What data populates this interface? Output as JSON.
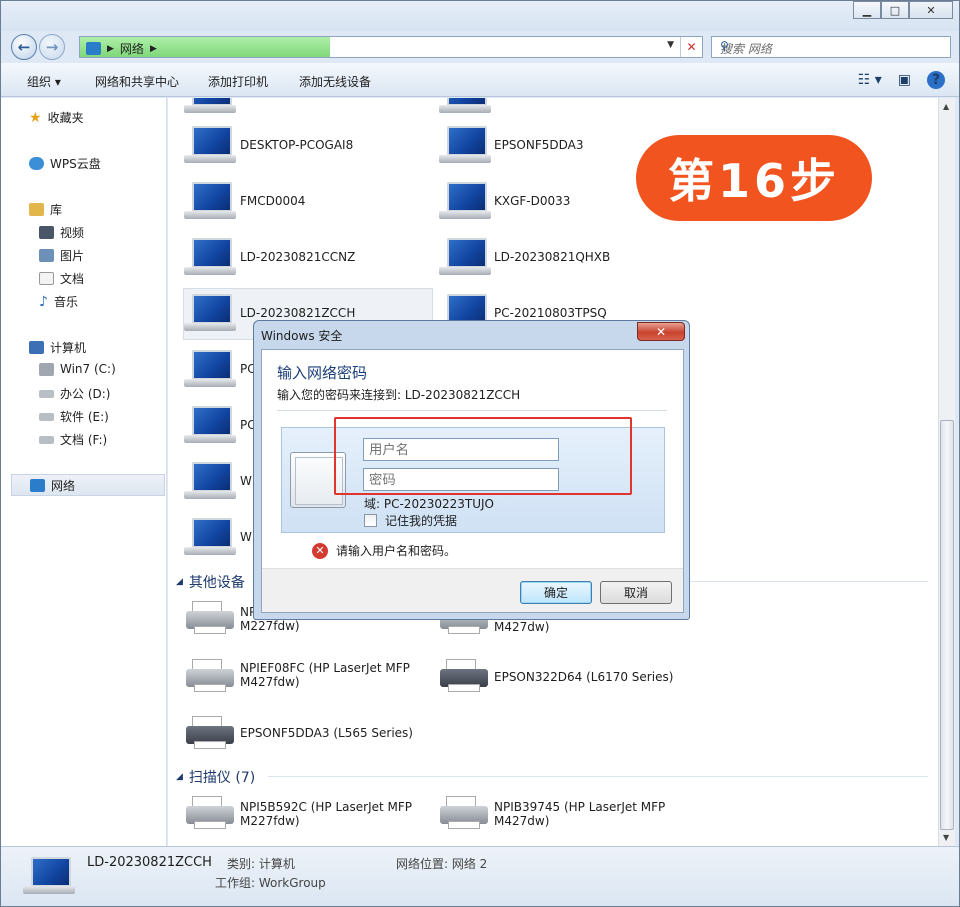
{
  "titlebar": {
    "buttons": [
      "minimize-icon",
      "maximize-icon",
      "close-icon"
    ]
  },
  "address": {
    "back_icon": "back-arrow-icon",
    "forward_icon": "forward-arrow-icon",
    "crumb": "网络",
    "search_placeholder": "搜索 网络"
  },
  "toolbar": {
    "organize": "组织",
    "network_center": "网络和共享中心",
    "add_printer": "添加打印机",
    "add_wireless": "添加无线设备"
  },
  "sidebar": {
    "favorites": "收藏夹",
    "wps": "WPS云盘",
    "libraries": "库",
    "lib_items": [
      "视频",
      "图片",
      "文档",
      "音乐"
    ],
    "computer": "计算机",
    "drives": [
      "Win7 (C:)",
      "办公 (D:)",
      "软件 (E:)",
      "文档 (F:)"
    ],
    "network": "网络"
  },
  "computers": {
    "col1": [
      "DESKTOP-PCOGAI8",
      "FMCD0004",
      "LD-20230821CCNZ",
      "LD-20230821ZCCH",
      "PC",
      "PC",
      "WI",
      "WI"
    ],
    "col2": [
      "EPSONF5DDA3",
      "KXGF-D0033",
      "LD-20230821QHXB",
      "PC-20210803TPSQ"
    ]
  },
  "other_devices": {
    "header": "其他设备",
    "items": [
      {
        "l1": "NPI",
        "l2": "M227fdw)"
      },
      {
        "l1": "",
        "l2": "M427dw)"
      },
      {
        "l1": "NPIEF08FC (HP LaserJet MFP",
        "l2": "M427fdw)"
      },
      {
        "l1": "EPSON322D64 (L6170 Series)",
        "l2": ""
      },
      {
        "l1": "EPSONF5DDA3 (L565 Series)",
        "l2": ""
      }
    ]
  },
  "scanners": {
    "header": "扫描仪 (7)",
    "items": [
      {
        "l1": "NPI5B592C (HP LaserJet MFP",
        "l2": "M227fdw)"
      },
      {
        "l1": "NPIB39745 (HP LaserJet MFP",
        "l2": "M427dw)"
      }
    ]
  },
  "status": {
    "name": "LD-20230821ZCCH",
    "category": "类别: 计算机",
    "workgroup": "工作组: WorkGroup",
    "location": "网络位置: 网络  2"
  },
  "badge": "第16步",
  "dialog": {
    "title": "Windows 安全",
    "close": "✕",
    "heading": "输入网络密码",
    "subheading": "输入您的密码来连接到: LD-20230821ZCCH",
    "username_placeholder": "用户名",
    "password_placeholder": "密码",
    "domain": "域: PC-20230223TUJO",
    "remember": "记住我的凭据",
    "error": "请输入用户名和密码。",
    "ok": "确定",
    "cancel": "取消"
  }
}
